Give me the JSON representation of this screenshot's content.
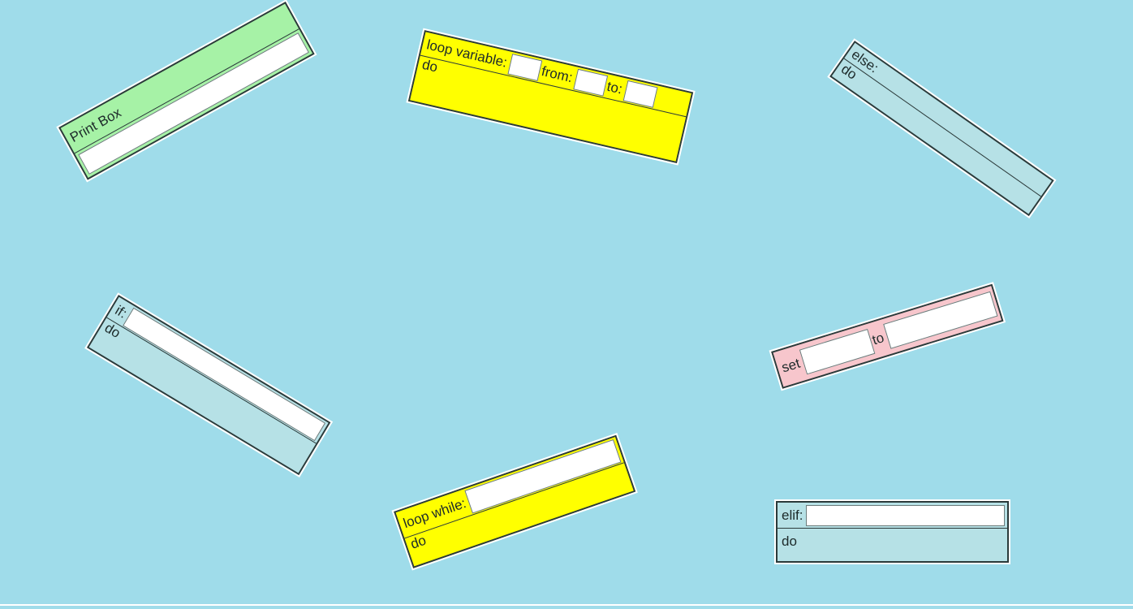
{
  "blocks": {
    "print": {
      "label": "Print Box",
      "value": ""
    },
    "loop_var": {
      "label": "loop variable:",
      "from_label": "from:",
      "to_label": "to:",
      "do_label": "do",
      "var_value": "",
      "from_value": "",
      "to_value": ""
    },
    "else": {
      "label": "else:",
      "do_label": "do"
    },
    "if": {
      "label": "if:",
      "do_label": "do",
      "value": ""
    },
    "set": {
      "label": "set",
      "to_label": "to",
      "var_value": "",
      "to_value": ""
    },
    "loop_while": {
      "label": "loop while:",
      "do_label": "do",
      "value": ""
    },
    "elif": {
      "label": "elif:",
      "do_label": "do",
      "value": ""
    }
  },
  "colors": {
    "background": "#9fdcea",
    "print": "#a6f2a6",
    "loop": "#ffff00",
    "conditional": "#b6e1e6",
    "set": "#f7c6cc"
  }
}
